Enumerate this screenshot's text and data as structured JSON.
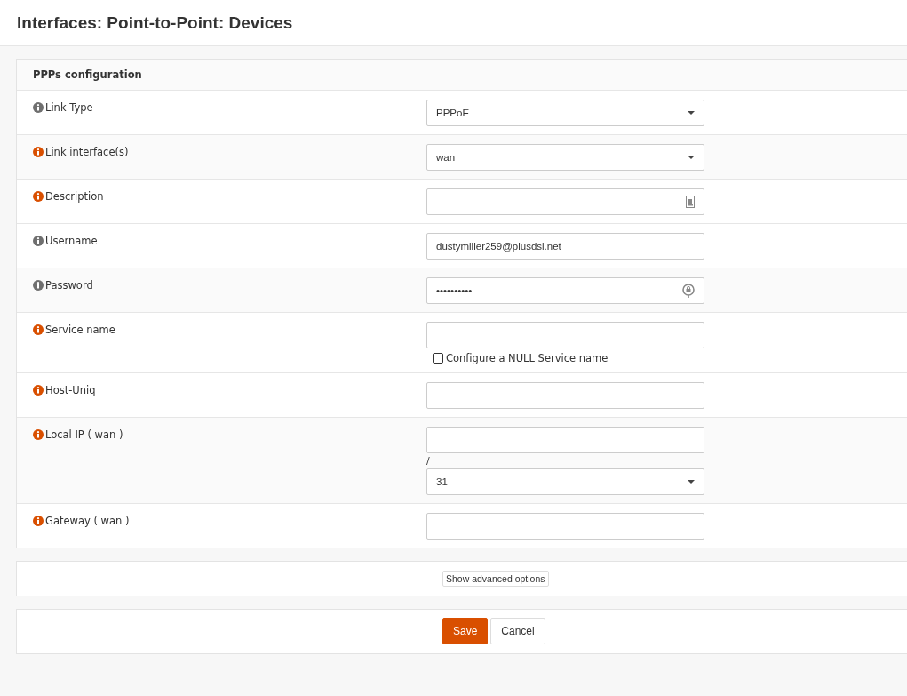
{
  "page_title": "Interfaces: Point-to-Point: Devices",
  "section": {
    "title": "PPPs configuration"
  },
  "rows": [
    {
      "label": "Link Type",
      "color": "#6f6f6f",
      "controls": [
        {
          "kind": "select",
          "value": "PPPoE"
        }
      ]
    },
    {
      "label": "Link interface(s)",
      "color": "#d94f00",
      "controls": [
        {
          "kind": "select",
          "value": "wan"
        }
      ]
    },
    {
      "label": "Description",
      "color": "#d94f00",
      "controls": [
        {
          "kind": "card_input"
        }
      ]
    },
    {
      "label": "Username",
      "color": "#6f6f6f",
      "controls": [
        {
          "kind": "input",
          "value": "dustymiller259@plusdsl.net"
        }
      ]
    },
    {
      "label": "Password",
      "color": "#6f6f6f",
      "controls": [
        {
          "kind": "password",
          "value": "••••••••••"
        }
      ]
    },
    {
      "label": "Service name",
      "color": "#d94f00",
      "controls": [
        {
          "kind": "input"
        },
        {
          "kind": "checkbox",
          "label": "Configure a NULL Service name",
          "checked": false
        }
      ]
    },
    {
      "label": "Host-Uniq",
      "color": "#d94f00",
      "controls": [
        {
          "kind": "input"
        }
      ]
    },
    {
      "label": "Local IP ( wan )",
      "color": "#d94f00",
      "controls": [
        {
          "kind": "input"
        },
        {
          "kind": "separator",
          "text": "/"
        },
        {
          "kind": "select",
          "value": "31"
        }
      ]
    },
    {
      "label": "Gateway ( wan )",
      "color": "#d94f00",
      "controls": [
        {
          "kind": "input"
        }
      ]
    }
  ],
  "advanced_button": "Show advanced options",
  "buttons": [
    {
      "kind": "primary",
      "label": "Save"
    },
    {
      "kind": "default",
      "label": "Cancel"
    }
  ]
}
